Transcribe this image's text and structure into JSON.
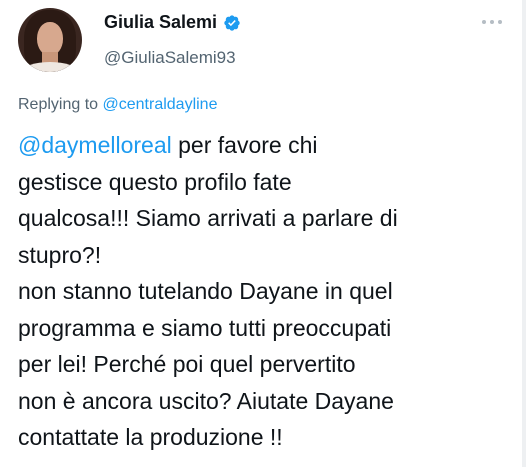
{
  "tweet": {
    "display_name": "Giulia Salemi",
    "handle": "@GiuliaSalemi93",
    "replying_prefix": "Replying to ",
    "replying_to": "@centraldayline",
    "mention": "@daymelloreal",
    "text_after_mention": " per favore chi\ngestisce questo profilo fate\nqualcosa!!! Siamo arrivati a parlare di\nstupro?!\nnon stanno tutelando Dayane in quel\nprogramma e siamo tutti preoccupati\nper lei! Perché poi quel pervertito\nnon è ancora uscito? Aiutate Dayane\ncontattate la produzione !!",
    "verified_icon": "verified-badge-icon",
    "more_icon": "more-options-icon"
  },
  "colors": {
    "link_blue": "#1d9bf0",
    "text_primary": "#0f1419",
    "text_secondary": "#536471",
    "verified_blue": "#1d9bf0"
  }
}
